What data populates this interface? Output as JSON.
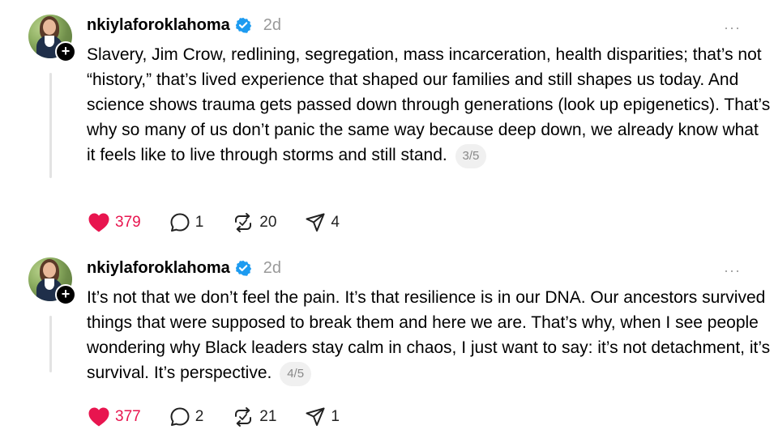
{
  "colors": {
    "like": "#e8154f",
    "verified": "#1d9bf0",
    "muted": "#999999",
    "thread_line": "#e3e3e3"
  },
  "posts": [
    {
      "username": "nkiylaforoklahoma",
      "time": "2d",
      "more": "···",
      "text": "Slavery, Jim Crow, redlining, segregation, mass incarceration, health disparities; that’s not “history,” that’s lived experience that shaped our families and still shapes us today. And science shows trauma gets passed down through generations (look up epigenetics). That’s why so many of us don’t panic the same way because deep down, we already know what it feels like to live through storms and still stand.",
      "pager": "3/5",
      "likes": "379",
      "replies": "1",
      "reposts": "20",
      "shares": "4",
      "icons": [
        "heart-filled-icon",
        "comment-icon",
        "repost-icon",
        "share-icon"
      ]
    },
    {
      "username": "nkiylaforoklahoma",
      "time": "2d",
      "more": "···",
      "text": "It’s not that we don’t feel the pain. It’s that resilience is in our DNA. Our ancestors survived things that were supposed to break them and here we are. That’s why, when I see people wondering why Black leaders stay calm in chaos, I just want to say: it’s not detachment, it’s survival. It’s perspective.",
      "pager": "4/5",
      "likes": "377",
      "replies": "2",
      "reposts": "21",
      "shares": "1",
      "icons": [
        "heart-filled-icon",
        "comment-icon",
        "repost-icon",
        "share-icon"
      ]
    }
  ]
}
